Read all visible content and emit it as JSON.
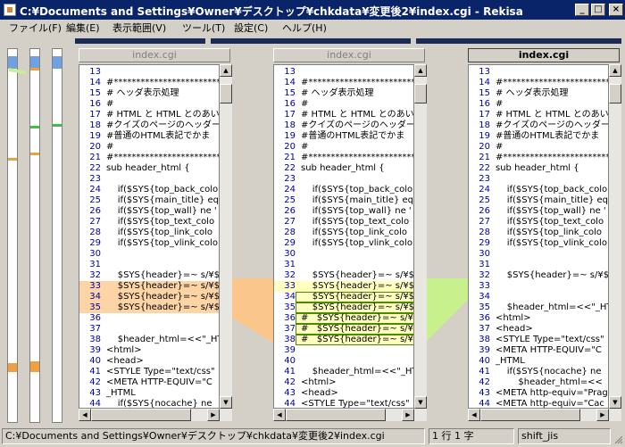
{
  "window": {
    "title": "C:¥Documents and Settings¥Owner¥デスクトップ¥chkdata¥変更後2¥index.cgi - Rekisa",
    "minimize": "_",
    "maximize": "□",
    "close": "×"
  },
  "menu": [
    "ファイル(F)",
    "編集(E)",
    "表示範囲(V)",
    "ツール(T)",
    "設定(C)",
    "ヘルプ(H)"
  ],
  "colors": {
    "titlebar": "#0a246a",
    "diff_orange": "#fdd4a6",
    "diff_orange_band": "#fbc68c",
    "diff_yellow": "#ffffc0",
    "diff_green": "#c8f08c",
    "line_number": "#0000a0"
  },
  "panes": [
    {
      "tab": "index.cgi",
      "active": false,
      "lines": [
        {
          "n": "13",
          "t": ""
        },
        {
          "n": "14",
          "t": "#*************************"
        },
        {
          "n": "15",
          "t": "# ヘッダ表示処理"
        },
        {
          "n": "16",
          "t": "#"
        },
        {
          "n": "17",
          "t": "# HTML と HTML とのあい"
        },
        {
          "n": "18",
          "t": "#クイズのページのヘッダー部"
        },
        {
          "n": "19",
          "t": "#普通のHTML表記でかま"
        },
        {
          "n": "20",
          "t": "#"
        },
        {
          "n": "21",
          "t": "#*************************"
        },
        {
          "n": "22",
          "t": "sub header_html {"
        },
        {
          "n": "23",
          "t": ""
        },
        {
          "n": "24",
          "t": "    if($SYS{top_back_colo"
        },
        {
          "n": "25",
          "t": "    if($SYS{main_title} eq"
        },
        {
          "n": "26",
          "t": "    if($SYS{top_wall} ne '"
        },
        {
          "n": "27",
          "t": "    if($SYS{top_text_colo"
        },
        {
          "n": "28",
          "t": "    if($SYS{top_link_colo"
        },
        {
          "n": "29",
          "t": "    if($SYS{top_vlink_colo"
        },
        {
          "n": "30",
          "t": ""
        },
        {
          "n": "31",
          "t": ""
        },
        {
          "n": "32",
          "t": "    $SYS{header}=~ s/¥$"
        },
        {
          "n": "33",
          "t": "    $SYS{header}=~ s/¥$",
          "hl": "orange"
        },
        {
          "n": "34",
          "t": "    $SYS{header}=~ s/¥$",
          "hl": "orange"
        },
        {
          "n": "35",
          "t": "    $SYS{header}=~ s/¥$",
          "hl": "orange"
        },
        {
          "n": "36",
          "t": ""
        },
        {
          "n": "37",
          "t": ""
        },
        {
          "n": "38",
          "t": "    $header_html=<<\"_HT"
        },
        {
          "n": "39",
          "t": "<html>"
        },
        {
          "n": "40",
          "t": "<head>"
        },
        {
          "n": "41",
          "t": "<STYLE Type=\"text/css\""
        },
        {
          "n": "42",
          "t": "<META HTTP-EQUIV=\"C"
        },
        {
          "n": "43",
          "t": "_HTML"
        },
        {
          "n": "44",
          "t": "    if($SYS{nocache} ne"
        }
      ]
    },
    {
      "tab": "index.cgi",
      "active": false,
      "lines": [
        {
          "n": "13",
          "t": ""
        },
        {
          "n": "14",
          "t": "#*************************"
        },
        {
          "n": "15",
          "t": "# ヘッダ表示処理"
        },
        {
          "n": "16",
          "t": "#"
        },
        {
          "n": "17",
          "t": "# HTML と HTML とのあい"
        },
        {
          "n": "18",
          "t": "#クイズのページのヘッダー部"
        },
        {
          "n": "19",
          "t": "#普通のHTML表記でかま"
        },
        {
          "n": "20",
          "t": "#"
        },
        {
          "n": "21",
          "t": "#*************************"
        },
        {
          "n": "22",
          "t": "sub header_html {"
        },
        {
          "n": "23",
          "t": ""
        },
        {
          "n": "24",
          "t": "    if($SYS{top_back_colo"
        },
        {
          "n": "25",
          "t": "    if($SYS{main_title} eq"
        },
        {
          "n": "26",
          "t": "    if($SYS{top_wall} ne '"
        },
        {
          "n": "27",
          "t": "    if($SYS{top_text_colo"
        },
        {
          "n": "28",
          "t": "    if($SYS{top_link_colo"
        },
        {
          "n": "29",
          "t": "    if($SYS{top_vlink_colo"
        },
        {
          "n": "30",
          "t": ""
        },
        {
          "n": "31",
          "t": ""
        },
        {
          "n": "32",
          "t": "    $SYS{header}=~ s/¥$"
        },
        {
          "n": "33",
          "t": "    $SYS{header}=~ s/¥$",
          "hl": "yellow"
        },
        {
          "n": "34",
          "t": "    $SYS{header}=~ s/¥$",
          "hl": "yellowbox"
        },
        {
          "n": "35",
          "t": "    $SYS{header}=~ s/¥$",
          "hl": "yellowbox"
        },
        {
          "n": "36",
          "t": "#   $SYS{header}=~ s/¥$",
          "hl": "yellowbox"
        },
        {
          "n": "37",
          "t": "#   $SYS{header}=~ s/¥$",
          "hl": "yellowbox"
        },
        {
          "n": "38",
          "t": "#   $SYS{header}=~ s/¥$",
          "hl": "yellowbox"
        },
        {
          "n": "39",
          "t": ""
        },
        {
          "n": "40",
          "t": ""
        },
        {
          "n": "41",
          "t": "    $header_html=<<\"_HT"
        },
        {
          "n": "42",
          "t": "<html>"
        },
        {
          "n": "43",
          "t": "<head>"
        },
        {
          "n": "44",
          "t": "<STYLE Type=\"text/css\""
        }
      ]
    },
    {
      "tab": "index.cgi",
      "active": true,
      "lines": [
        {
          "n": "13",
          "t": ""
        },
        {
          "n": "14",
          "t": "#*************************"
        },
        {
          "n": "15",
          "t": "# ヘッダ表示処理"
        },
        {
          "n": "16",
          "t": "#"
        },
        {
          "n": "17",
          "t": "# HTML と HTML とのあい"
        },
        {
          "n": "18",
          "t": "#クイズのページのヘッダー部"
        },
        {
          "n": "19",
          "t": "#普通のHTML表記でかま"
        },
        {
          "n": "20",
          "t": "#"
        },
        {
          "n": "21",
          "t": "#*************************"
        },
        {
          "n": "22",
          "t": "sub header_html {"
        },
        {
          "n": "23",
          "t": ""
        },
        {
          "n": "24",
          "t": "    if($SYS{top_back_colo"
        },
        {
          "n": "25",
          "t": "    if($SYS{main_title} eq"
        },
        {
          "n": "26",
          "t": "    if($SYS{top_wall} ne '"
        },
        {
          "n": "27",
          "t": "    if($SYS{top_text_colo"
        },
        {
          "n": "28",
          "t": "    if($SYS{top_link_colo"
        },
        {
          "n": "29",
          "t": "    if($SYS{top_vlink_colo"
        },
        {
          "n": "30",
          "t": ""
        },
        {
          "n": "31",
          "t": ""
        },
        {
          "n": "32",
          "t": "    $SYS{header}=~ s/¥$"
        },
        {
          "n": "33",
          "t": ""
        },
        {
          "n": "34",
          "t": ""
        },
        {
          "n": "35",
          "t": "    $header_html=<<\"_HT"
        },
        {
          "n": "36",
          "t": "<html>"
        },
        {
          "n": "37",
          "t": "<head>"
        },
        {
          "n": "38",
          "t": "<STYLE Type=\"text/css\""
        },
        {
          "n": "39",
          "t": "<META HTTP-EQUIV=\"C"
        },
        {
          "n": "40",
          "t": "_HTML"
        },
        {
          "n": "41",
          "t": "    if($SYS{nocache} ne"
        },
        {
          "n": "42",
          "t": "        $header_html=<<"
        },
        {
          "n": "43",
          "t": "<META http-equiv=\"Prag"
        },
        {
          "n": "44",
          "t": "<META http-equiv=\"Cac"
        }
      ]
    }
  ],
  "status": {
    "path": "C:¥Documents and Settings¥Owner¥デスクトップ¥chkdata¥変更後2¥index.cgi",
    "position": "1 行 1 字",
    "encoding": "shift_jis"
  }
}
